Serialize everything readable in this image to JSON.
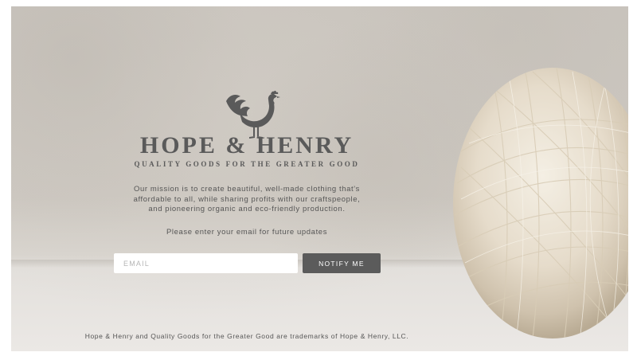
{
  "brand": {
    "name": "HOPE & HENRY",
    "tagline": "QUALITY GOODS FOR THE GREATER GOOD",
    "logo_icon": "rooster-icon"
  },
  "main": {
    "mission_lines": [
      "Our mission is to create beautiful, well-made clothing that's",
      "affordable to all, while sharing profits with our craftspeople,",
      "and pioneering organic and eco-friendly production."
    ],
    "prompt": "Please enter your email for future updates"
  },
  "signup": {
    "email_placeholder": "EMAIL",
    "email_value": "",
    "button_label": "NOTIFY ME"
  },
  "footer": {
    "text": "Hope & Henry and Quality Goods for the Greater Good are trademarks of Hope & Henry, LLC."
  },
  "colors": {
    "text": "#5a5a5a",
    "button": "#5b5b5b",
    "background": "#ccc7c0"
  }
}
